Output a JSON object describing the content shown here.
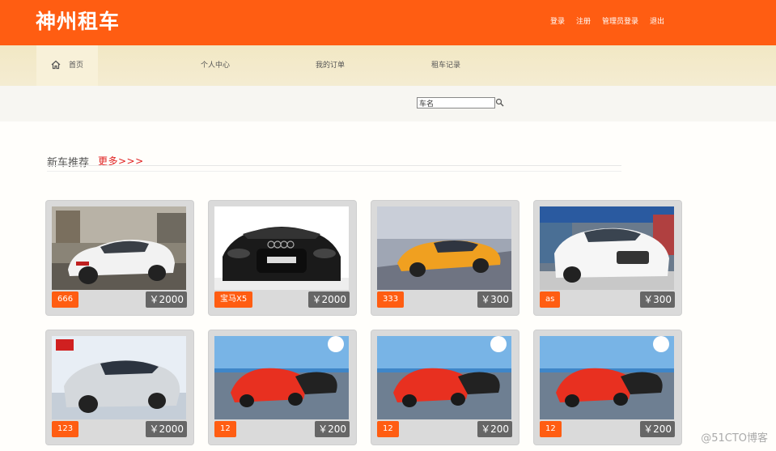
{
  "header": {
    "logo": "神州租车",
    "links": [
      "登录",
      "注册",
      "管理员登录",
      "退出"
    ]
  },
  "nav": {
    "home": "首页",
    "items": [
      "个人中心",
      "我的订单",
      "租车记录"
    ]
  },
  "search": {
    "value": "车名"
  },
  "section": {
    "title": "新车推荐",
    "more": "更多>>>"
  },
  "cars": [
    {
      "name": "666",
      "price": "￥2000",
      "image": "white-sedan-rear"
    },
    {
      "name": "宝马X5",
      "price": "￥2000",
      "image": "black-convertible-front"
    },
    {
      "name": "333",
      "price": "￥300",
      "image": "orange-coupe"
    },
    {
      "name": "as",
      "price": "￥300",
      "image": "white-sedan-showroom"
    },
    {
      "name": "123",
      "price": "￥2000",
      "image": "silver-sedan-kia"
    },
    {
      "name": "12",
      "price": "￥200",
      "image": "red-bmw-pair"
    },
    {
      "name": "12",
      "price": "￥200",
      "image": "red-bmw-pair"
    },
    {
      "name": "12",
      "price": "￥200",
      "image": "red-bmw-pair"
    }
  ],
  "watermark": "@51CTO博客",
  "colors": {
    "brand": "#ff5d12",
    "nav": "#f2e8c4",
    "price_tag": "#666666"
  }
}
